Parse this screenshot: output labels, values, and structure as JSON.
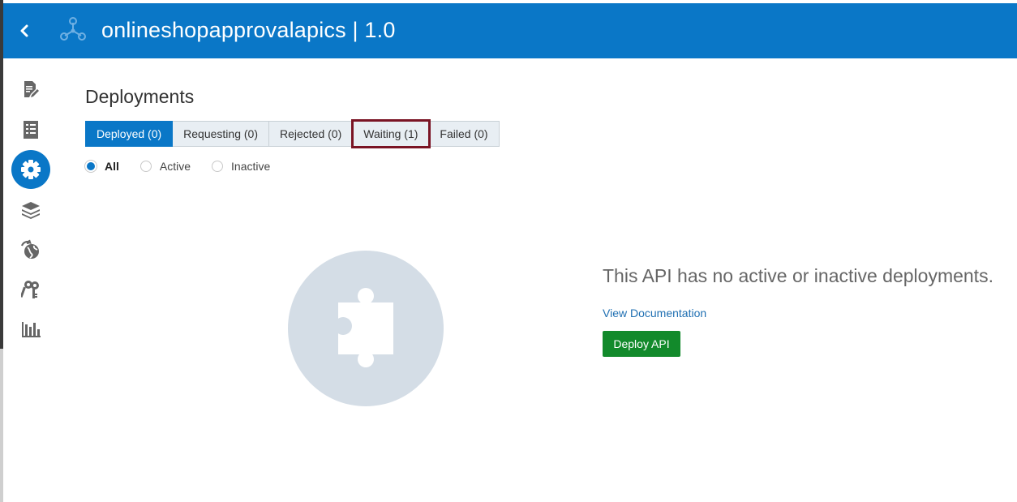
{
  "header": {
    "title": "onlineshopapprovalapics | 1.0"
  },
  "sidebar": {
    "items": [
      {
        "icon": "document-edit-icon"
      },
      {
        "icon": "checklist-icon"
      },
      {
        "icon": "gear-icon",
        "active": true
      },
      {
        "icon": "layers-icon"
      },
      {
        "icon": "globe-share-icon"
      },
      {
        "icon": "keys-icon"
      },
      {
        "icon": "bar-chart-icon"
      }
    ]
  },
  "main": {
    "title": "Deployments",
    "tabs": [
      {
        "label": "Deployed (0)",
        "active": true
      },
      {
        "label": "Requesting (0)"
      },
      {
        "label": "Rejected (0)"
      },
      {
        "label": "Waiting (1)",
        "highlighted": true
      },
      {
        "label": "Failed (0)"
      }
    ],
    "filter": {
      "options": [
        "All",
        "Active",
        "Inactive"
      ],
      "selected": "All"
    },
    "empty_state": {
      "icon": "puzzle-piece-icon",
      "message": "This API has no active or inactive deployments.",
      "link": "View Documentation",
      "button": "Deploy API"
    }
  },
  "colors": {
    "accent": "#0a77c7",
    "deploy_button": "#128a2b",
    "highlight_box": "#7a1424",
    "placeholder": "#d4dde6"
  }
}
